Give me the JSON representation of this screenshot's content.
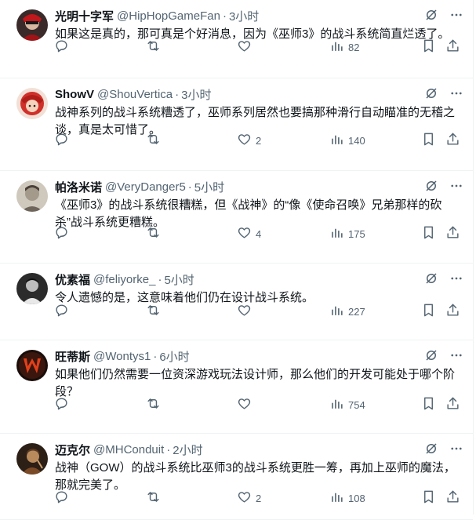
{
  "colors": {
    "text": "#0f1419",
    "muted": "#536471",
    "divider": "#eff3f4"
  },
  "tweets": [
    {
      "name": "光明十字军",
      "handle": "@HipHopGameFan",
      "time": "3小时",
      "text": "如果这是真的，那可真是个好消息，因为《巫师3》的战斗系统简直烂透了。",
      "replies": "",
      "reposts": "",
      "likes": "",
      "views": "82",
      "avatar": "red-masked-character"
    },
    {
      "name": "ShowV",
      "handle": "@ShouVertica",
      "time": "3小时",
      "text": "战神系列的战斗系统糟透了，巫师系列居然也要搞那种滑行自动瞄准的无稽之谈，真是太可惜了。",
      "replies": "",
      "reposts": "",
      "likes": "2",
      "views": "140",
      "avatar": "red-haired-anime-character"
    },
    {
      "name": "帕洛米诺",
      "handle": "@VeryDanger5",
      "time": "5小时",
      "text": "《巫师3》的战斗系统很糟糕，但《战神》的“像《使命召唤》兄弟那样的砍杀”战斗系统更糟糕。",
      "replies": "",
      "reposts": "",
      "likes": "4",
      "views": "175",
      "avatar": "vintage-photo-portrait"
    },
    {
      "name": "优素福",
      "handle": "@feliyorke_",
      "time": "5小时",
      "text": "令人遗憾的是，这意味着他们仍在设计战斗系统。",
      "replies": "",
      "reposts": "",
      "likes": "",
      "views": "227",
      "avatar": "black-and-white-portrait"
    },
    {
      "name": "旺蒂斯",
      "handle": "@Wontys1",
      "time": "6小时",
      "text": "如果他们仍然需要一位资深游戏玩法设计师，那么他们的开发可能处于哪个阶段？",
      "replies": "",
      "reposts": "",
      "likes": "",
      "views": "754",
      "avatar": "witcher-w-logo"
    },
    {
      "name": "迈克尔",
      "handle": "@MHConduit",
      "time": "2小时",
      "text": "战神（GOW）的战斗系统比巫师3的战斗系统更胜一筹，再加上巫师的魔法，那就完美了。",
      "replies": "",
      "reposts": "",
      "likes": "2",
      "views": "108",
      "avatar": "warrior-portrait"
    }
  ]
}
